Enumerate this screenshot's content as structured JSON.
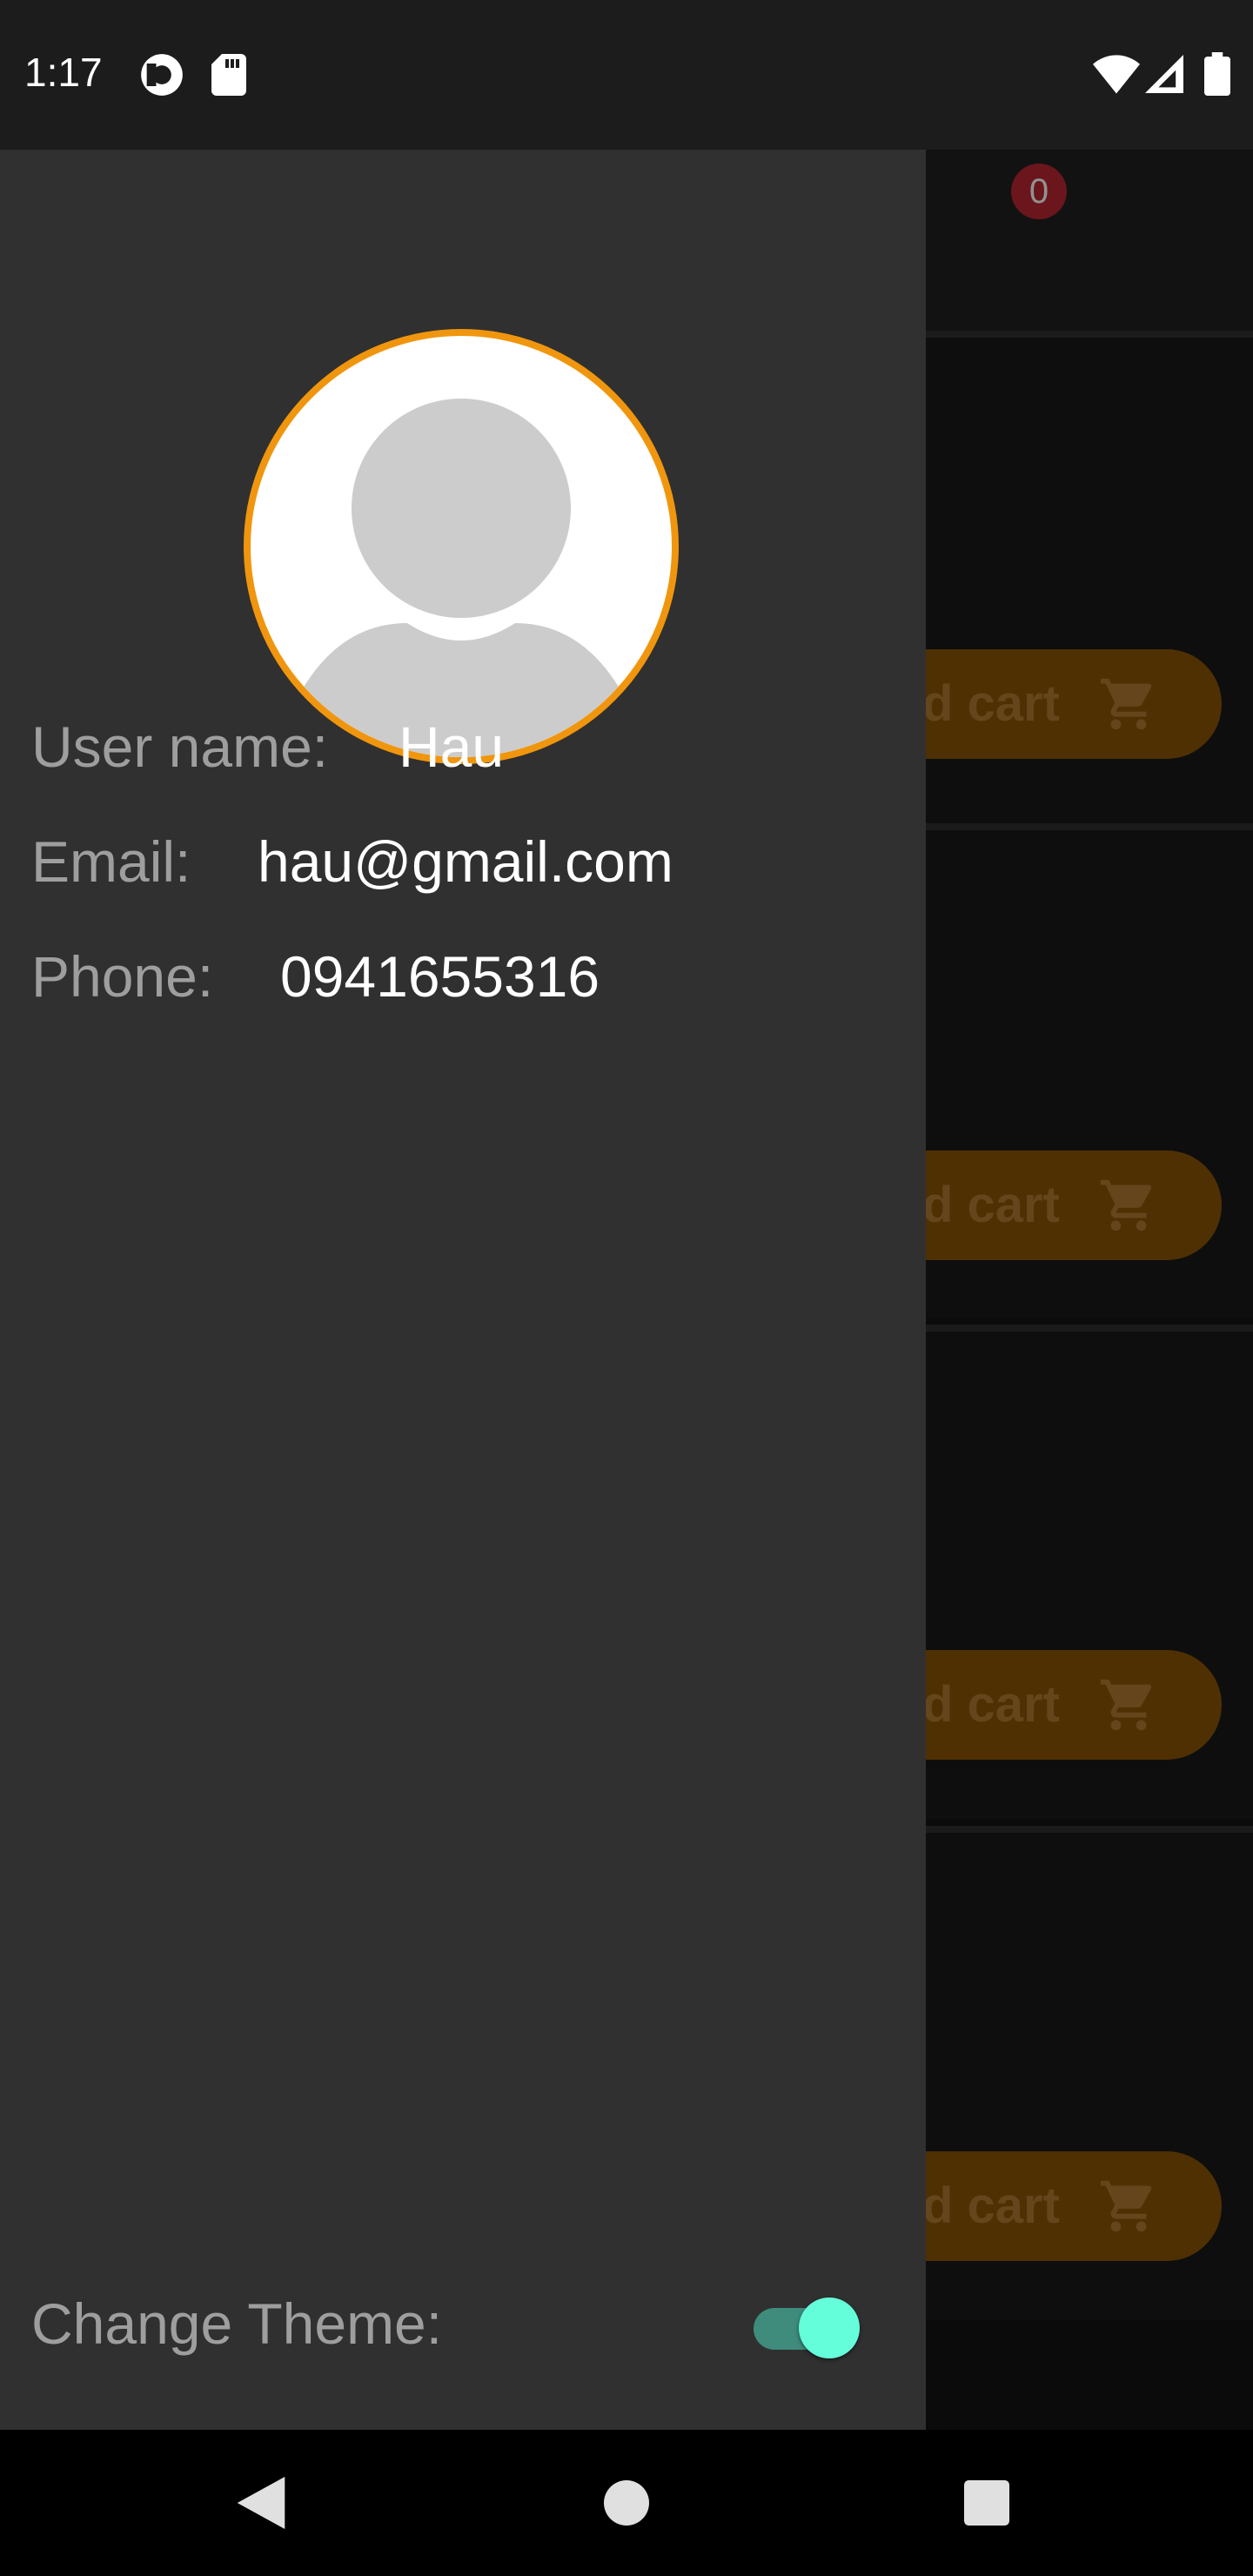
{
  "status_bar": {
    "time": "1:17",
    "icons": [
      "pocket-casts-icon",
      "sd-card-icon",
      "wifi-icon",
      "signal-icon",
      "battery-icon"
    ]
  },
  "app_bar": {
    "cart_badge": "0",
    "icons": [
      "cart-icon",
      "logout-icon"
    ]
  },
  "products": [
    {
      "add_cart_label": "d cart"
    },
    {
      "add_cart_label": "d cart"
    },
    {
      "add_cart_label": "d cart"
    },
    {
      "add_cart_label": "d cart"
    }
  ],
  "drawer": {
    "username_label": "User name:",
    "username_value": "Hau",
    "email_label": "Email:",
    "email_value": "hau@gmail.com",
    "phone_label": "Phone:",
    "phone_value": "0941655316",
    "theme_label": "Change Theme:",
    "theme_toggle_on": true
  },
  "colors": {
    "drawer_bg": "#303030",
    "avatar_border": "#f0960e",
    "toggle_thumb": "#64ffda",
    "add_cart_bg": "#7a4a05"
  }
}
